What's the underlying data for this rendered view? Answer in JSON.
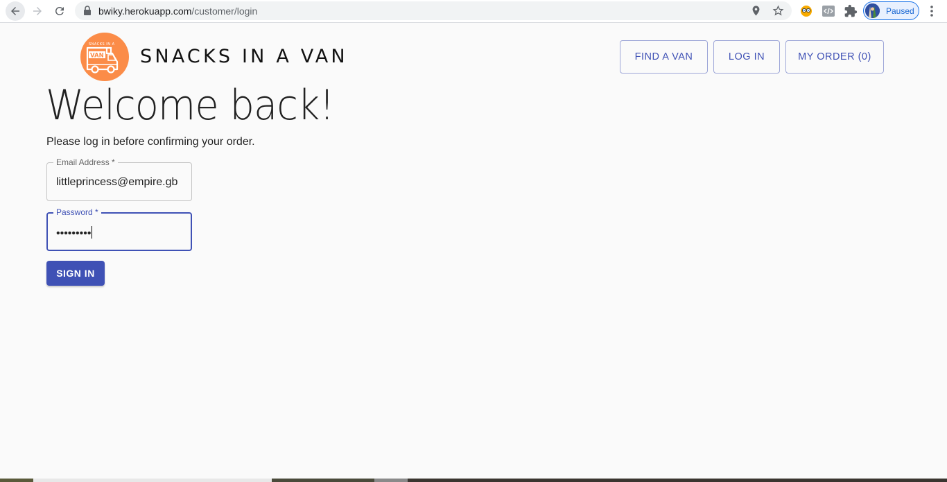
{
  "browser": {
    "url_host": "bwiky.herokuapp.com",
    "url_path": "/customer/login",
    "profile_status": "Paused",
    "icons": [
      "back-arrow-icon",
      "forward-arrow-icon",
      "reload-icon",
      "lock-icon",
      "location-icon",
      "star-icon",
      "extension-icon",
      "code-icon",
      "puzzle-icon",
      "kebab-menu-icon"
    ]
  },
  "header": {
    "brand": "SNACKS IN A VAN",
    "logo_text_top": "SNACKS IN A",
    "logo_text_van": "VAN",
    "nav": {
      "find_van": "FIND A VAN",
      "log_in": "LOG IN",
      "my_order": "MY ORDER (0)"
    }
  },
  "main": {
    "title": "Welcome back!",
    "subtitle": "Please log in before confirming your order.",
    "email": {
      "label": "Email Address *",
      "value": "littleprincess@empire.gb"
    },
    "password": {
      "label": "Password *",
      "value": "•••••••••"
    },
    "submit_label": "SIGN IN"
  },
  "colors": {
    "primary": "#3f51b5",
    "logo_orange": "#fb8c48",
    "background": "#fafafa"
  }
}
